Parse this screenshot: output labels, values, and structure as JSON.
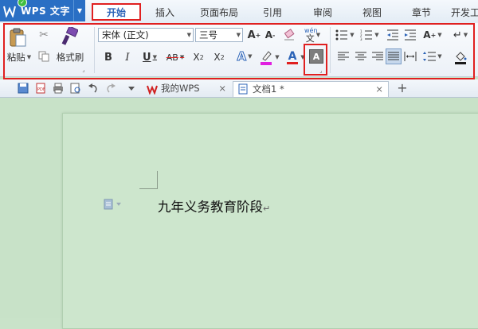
{
  "app": {
    "title": "WPS 文字",
    "dropdown_icon": "chevron-down-icon"
  },
  "menu_tabs": [
    {
      "label": "开始",
      "active": true
    },
    {
      "label": "插入"
    },
    {
      "label": "页面布局"
    },
    {
      "label": "引用"
    },
    {
      "label": "审阅"
    },
    {
      "label": "视图"
    },
    {
      "label": "章节"
    },
    {
      "label": "开发工"
    }
  ],
  "ribbon": {
    "paste_label": "粘贴",
    "format_painter_label": "格式刷",
    "font_name": "宋体 (正文)",
    "font_size": "三号",
    "highlight_color": "#e020e0",
    "font_color": "#e02020",
    "fill_color": "#1a1a1a"
  },
  "doc_tabs": [
    {
      "label": "我的WPS",
      "active": false
    },
    {
      "label": "文档1 *",
      "active": true
    }
  ],
  "document": {
    "text": "九年义务教育阶段",
    "para_mark": "↵"
  },
  "colors": {
    "app_button": "#2a6fc4",
    "highlight_box": "#e02020",
    "doc_background": "#c8e2c8"
  }
}
